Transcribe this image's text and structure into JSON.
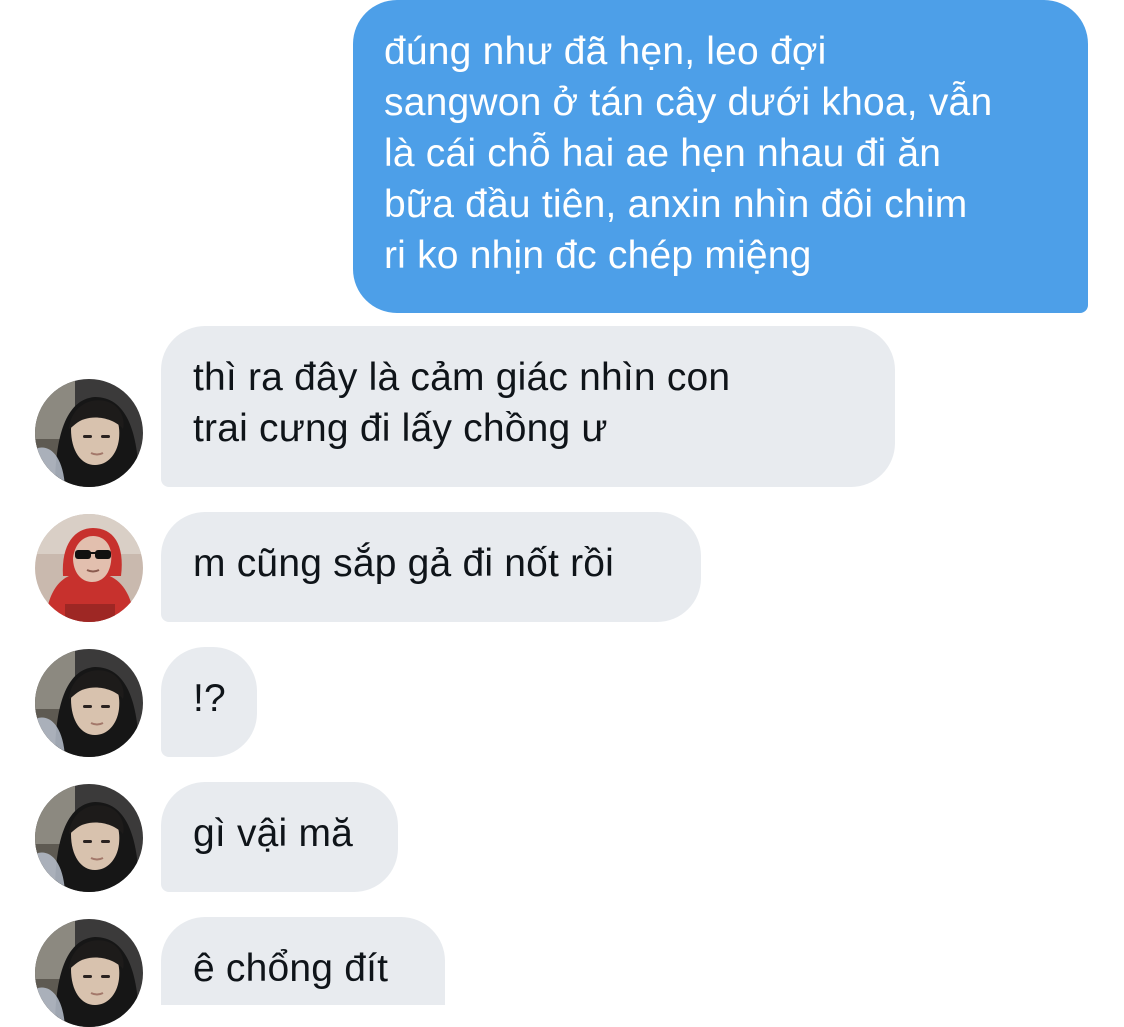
{
  "conversation": {
    "messages": [
      {
        "direction": "outgoing",
        "text": "đúng như đã hẹn, leo đợi\nsangwon ở tán cây dưới khoa, vẫn\nlà cái chỗ hai ae hẹn nhau đi ăn\nbữa đầu tiên, anxin nhìn đôi chim\nri ko nhịn đc chép miệng"
      },
      {
        "direction": "incoming",
        "avatar": "avatar-hooded-dark",
        "text": "thì ra đây là cảm giác nhìn con\ntrai cưng đi lấy chồng ư"
      },
      {
        "direction": "incoming",
        "avatar": "avatar-red-hoodie-sunglasses",
        "text": "m cũng sắp gả đi nốt rồi"
      },
      {
        "direction": "incoming",
        "avatar": "avatar-hooded-dark",
        "text": "!?"
      },
      {
        "direction": "incoming",
        "avatar": "avatar-hooded-dark",
        "text": "gì vậi mă"
      },
      {
        "direction": "incoming",
        "avatar": "avatar-hooded-dark",
        "text": "ê chổng đít"
      }
    ]
  },
  "colors": {
    "outgoing_bubble": "#4d9fe8",
    "incoming_bubble": "#e8ebef",
    "incoming_text": "#0f1419",
    "outgoing_text": "#ffffff"
  }
}
